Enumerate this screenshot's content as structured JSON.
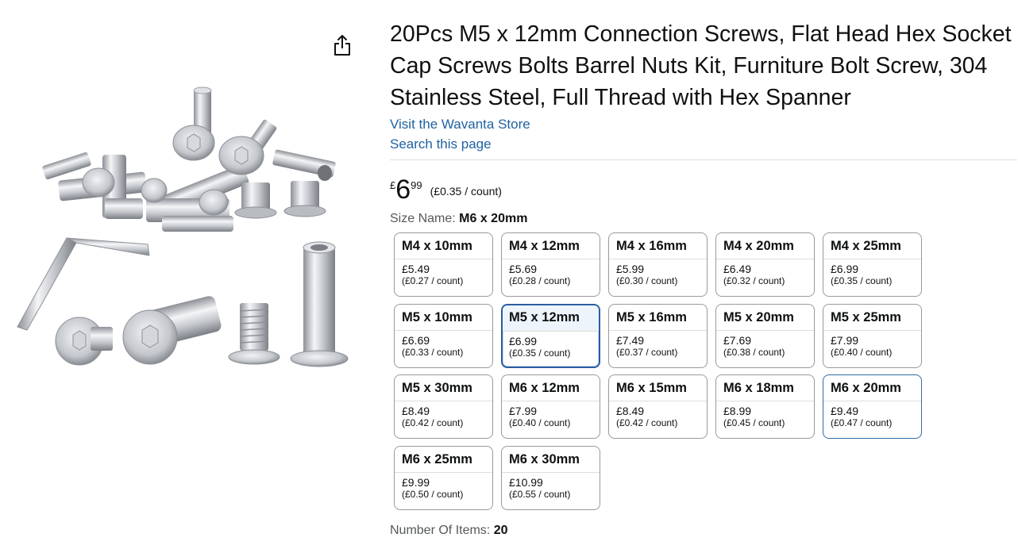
{
  "product": {
    "title": "20Pcs M5 x 12mm Connection Screws, Flat Head Hex Socket Cap Screws Bolts Barrel Nuts Kit, Furniture Bolt Screw, 304 Stainless Steel, Full Thread with Hex Spanner",
    "store_link": "Visit the Wavanta Store",
    "search_link": "Search this page",
    "share_icon": "share-icon",
    "image_alt": "product-image"
  },
  "price": {
    "symbol": "£",
    "whole": "6",
    "fraction": "99",
    "unit": "(£0.35 / count)"
  },
  "size": {
    "label": "Size Name:",
    "selected": "M6 x 20mm",
    "selected_tile_index": 6,
    "hovered_tile_index": 14,
    "options": [
      {
        "name": "M4 x 10mm",
        "price": "£5.49",
        "unit": "(£0.27 / count)"
      },
      {
        "name": "M4 x 12mm",
        "price": "£5.69",
        "unit": "(£0.28 / count)"
      },
      {
        "name": "M4 x 16mm",
        "price": "£5.99",
        "unit": "(£0.30 / count)"
      },
      {
        "name": "M4 x 20mm",
        "price": "£6.49",
        "unit": "(£0.32 / count)"
      },
      {
        "name": "M4 x 25mm",
        "price": "£6.99",
        "unit": "(£0.35 / count)"
      },
      {
        "name": "M5 x 10mm",
        "price": "£6.69",
        "unit": "(£0.33 / count)"
      },
      {
        "name": "M5 x 12mm",
        "price": "£6.99",
        "unit": "(£0.35 / count)"
      },
      {
        "name": "M5 x 16mm",
        "price": "£7.49",
        "unit": "(£0.37 / count)"
      },
      {
        "name": "M5 x 20mm",
        "price": "£7.69",
        "unit": "(£0.38 / count)"
      },
      {
        "name": "M5 x 25mm",
        "price": "£7.99",
        "unit": "(£0.40 / count)"
      },
      {
        "name": "M5 x 30mm",
        "price": "£8.49",
        "unit": "(£0.42 / count)"
      },
      {
        "name": "M6 x 12mm",
        "price": "£7.99",
        "unit": "(£0.40 / count)"
      },
      {
        "name": "M6 x 15mm",
        "price": "£8.49",
        "unit": "(£0.42 / count)"
      },
      {
        "name": "M6 x 18mm",
        "price": "£8.99",
        "unit": "(£0.45 / count)"
      },
      {
        "name": "M6 x 20mm",
        "price": "£9.49",
        "unit": "(£0.47 / count)"
      },
      {
        "name": "M6 x 25mm",
        "price": "£9.99",
        "unit": "(£0.50 / count)"
      },
      {
        "name": "M6 x 30mm",
        "price": "£10.99",
        "unit": "(£0.55 / count)"
      }
    ]
  },
  "items": {
    "label": "Number Of Items:",
    "value": "20"
  },
  "colors": {
    "link": "#2162a1",
    "selected_border": "#2a5da0",
    "text": "#0f1111",
    "muted": "#565959"
  }
}
